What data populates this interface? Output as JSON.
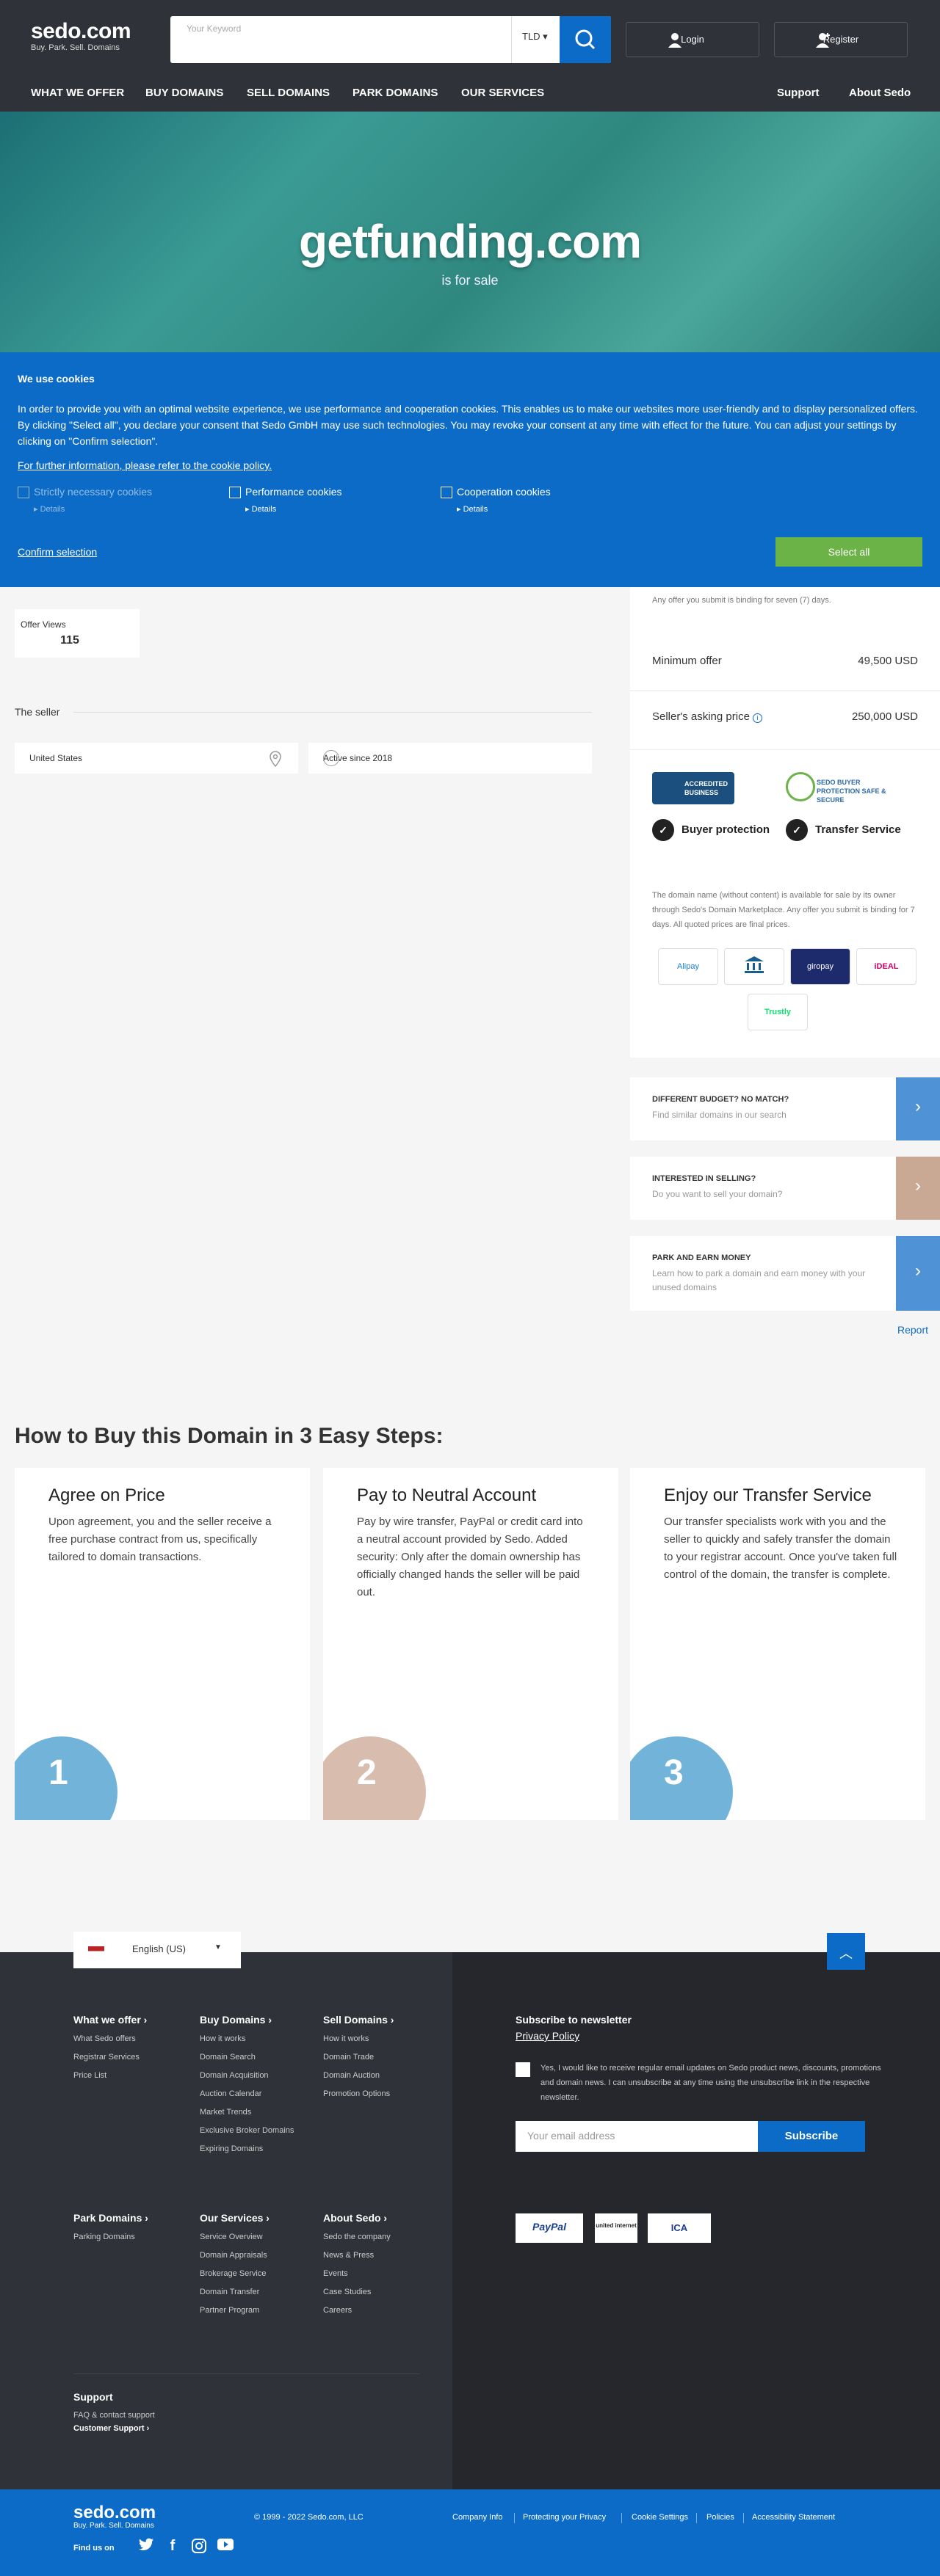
{
  "header": {
    "logo": "sedo.com",
    "logo_tagline": "Buy. Park. Sell. Domains",
    "search_placeholder": "Your Keyword",
    "tld_label": "TLD",
    "login_label": "Login",
    "register_label": "Register",
    "nav": [
      "WHAT WE OFFER",
      "BUY DOMAINS",
      "SELL DOMAINS",
      "PARK DOMAINS",
      "OUR SERVICES"
    ],
    "nav_right": [
      "Support",
      "About Sedo"
    ]
  },
  "hero": {
    "domain": "getfunding.com",
    "subtitle": "is for sale"
  },
  "cookie": {
    "title": "We use cookies",
    "text": "In order to provide you with an optimal website experience, we use performance and cooperation cookies. This enables us to make our websites more user-friendly and to display personalized offers. By clicking \"Select all\", you declare your consent that Sedo GmbH may use such technologies. You may revoke your consent at any time with effect for the future. You can adjust your settings by clicking on \"Confirm selection\".",
    "link": "For further information, please refer to the cookie policy.",
    "options": [
      {
        "label": "Strictly necessary cookies",
        "details": "Details"
      },
      {
        "label": "Performance cookies",
        "details": "Details"
      },
      {
        "label": "Cooperation cookies",
        "details": "Details"
      }
    ],
    "confirm": "Confirm selection",
    "select_all": "Select all"
  },
  "stats": {
    "offer_views_label": "Offer Views",
    "offer_views_value": "115"
  },
  "seller": {
    "heading": "The seller",
    "country": "United States",
    "active": "Active since 2018"
  },
  "offer": {
    "binding_note": "Any offer you submit is binding for seven (7) days.",
    "min_label": "Minimum offer",
    "min_value": "49,500 USD",
    "ask_label": "Seller's asking price",
    "ask_value": "250,000 USD"
  },
  "trust": {
    "bbb": "ACCREDITED BUSINESS",
    "sbp": "SEDO BUYER PROTECTION SAFE & SECURE",
    "feature1": "Buyer protection",
    "feature2": "Transfer Service",
    "desc": "The domain name (without content) is available for sale by its owner through Sedo's Domain Marketplace. Any offer you submit is binding for 7 days. All quoted prices are final prices.",
    "payments": [
      "Alipay",
      "Bank",
      "giropay",
      "iDEAL",
      "Trustly"
    ]
  },
  "promos": [
    {
      "title": "DIFFERENT BUDGET? NO MATCH?",
      "sub": "Find similar domains in our search",
      "color": "#4f93d6"
    },
    {
      "title": "INTERESTED IN SELLING?",
      "sub": "Do you want to sell your domain?",
      "color": "#c9a994"
    },
    {
      "title": "PARK AND EARN MONEY",
      "sub": "Learn how to park a domain and earn money with your unused domains",
      "color": "#4f93d6"
    }
  ],
  "report": "Report",
  "howto": {
    "title": "How to Buy this Domain in 3 Easy Steps:",
    "steps": [
      {
        "title": "Agree on Price",
        "text": "Upon agreement, you and the seller receive a free purchase contract from us, specifically tailored to domain transactions.",
        "num": "1",
        "color": "#72b4d9"
      },
      {
        "title": "Pay to Neutral Account",
        "text": "Pay by wire transfer, PayPal or credit card into a neutral account provided by Sedo. Added security: Only after the domain ownership has officially changed hands the seller will be paid out.",
        "num": "2",
        "color": "#d8bcae"
      },
      {
        "title": "Enjoy our Transfer Service",
        "text": "Our transfer specialists work with you and the seller to quickly and safely transfer the domain to your registrar account. Once you've taken full control of the domain, the transfer is complete.",
        "num": "3",
        "color": "#72b4d9"
      }
    ]
  },
  "footer": {
    "language": "English (US)",
    "col1": {
      "title": "What we offer",
      "items": [
        "What Sedo offers",
        "Registrar Services",
        "Price List"
      ]
    },
    "col2": {
      "title": "Buy Domains",
      "items": [
        "How it works",
        "Domain Search",
        "Domain Acquisition",
        "Auction Calendar",
        "Market Trends",
        "Exclusive Broker Domains",
        "Expiring Domains"
      ]
    },
    "col3": {
      "title": "Sell Domains",
      "items": [
        "How it works",
        "Domain Trade",
        "Domain Auction",
        "Promotion Options"
      ]
    },
    "col4": {
      "title": "Park Domains",
      "items": [
        "Parking Domains"
      ]
    },
    "col5": {
      "title": "Our Services",
      "items": [
        "Service Overview",
        "Domain Appraisals",
        "Brokerage Service",
        "Domain Transfer",
        "Partner Program"
      ]
    },
    "col6": {
      "title": "About Sedo",
      "items": [
        "Sedo the company",
        "News & Press",
        "Events",
        "Case Studies",
        "Careers"
      ]
    },
    "newsletter": {
      "title": "Subscribe to newsletter",
      "privacy": "Privacy Policy",
      "consent": "Yes, I would like to receive regular email updates on Sedo product news, discounts, promotions and domain news. I can unsubscribe at any time using the unsubscribe link in the respective newsletter.",
      "placeholder": "Your email address",
      "button": "Subscribe"
    },
    "badges": [
      "PayPal",
      "united internet",
      "ICA"
    ],
    "support_title": "Support",
    "support_items": [
      "FAQ & contact support",
      "Customer Support"
    ]
  },
  "bottom": {
    "logo": "sedo.com",
    "tagline": "Buy. Park. Sell. Domains",
    "copyright": "© 1999 - 2022 Sedo.com, LLC",
    "links": [
      "Company Info",
      "Protecting your Privacy",
      "Cookie Settings",
      "Policies",
      "Accessibility Statement"
    ],
    "find_us": "Find us on"
  }
}
